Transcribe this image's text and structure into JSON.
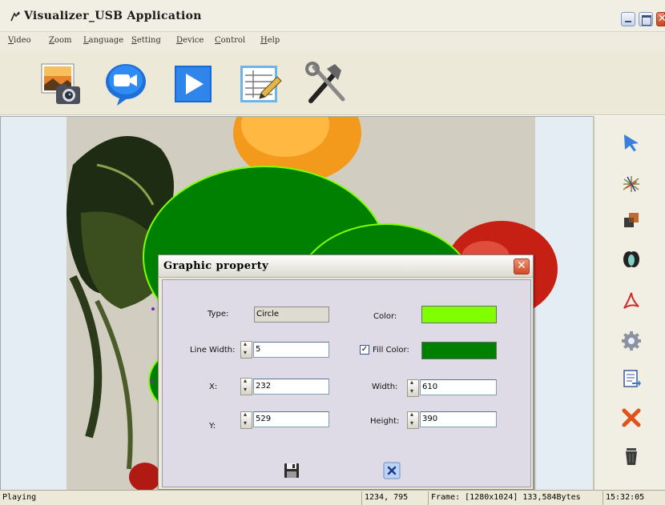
{
  "window": {
    "title": "Visualizer_USB Application"
  },
  "menu": [
    "Video",
    "Zoom",
    "Language",
    "Setting",
    "Device",
    "Control",
    "Help"
  ],
  "toolbar": [
    {
      "icon": "camera-photo-icon"
    },
    {
      "icon": "video-record-icon"
    },
    {
      "icon": "play-icon"
    },
    {
      "icon": "edit-sheet-icon"
    },
    {
      "icon": "tools-icon"
    }
  ],
  "tools": [
    {
      "icon": "select-arrow-icon"
    },
    {
      "icon": "scatter-lines-icon"
    },
    {
      "icon": "shapes-icon"
    },
    {
      "icon": "spotlight-icon"
    },
    {
      "icon": "pdf-icon"
    },
    {
      "icon": "settings-gear-icon"
    },
    {
      "icon": "export-sheet-icon"
    },
    {
      "icon": "delete-x-icon"
    },
    {
      "icon": "trash-icon"
    }
  ],
  "dialog": {
    "title": "Graphic property",
    "type_label": "Type:",
    "type_value": "Circle",
    "line_width_label": "Line Width:",
    "line_width_value": "5",
    "x_label": "X:",
    "x_value": "232",
    "y_label": "Y:",
    "y_value": "529",
    "color_label": "Color:",
    "fill_color_label": "Fill Color:",
    "fill_color_checked": "✓",
    "width_label": "Width:",
    "width_value": "610",
    "height_label": "Height:",
    "height_value": "390",
    "colors": {
      "line": "#80ff00",
      "fill": "#008000"
    }
  },
  "status": {
    "state": "Playing",
    "coords": "1234, 795",
    "frame": "Frame: [1280x1024] 133,584Bytes",
    "time": "15:32:05"
  }
}
